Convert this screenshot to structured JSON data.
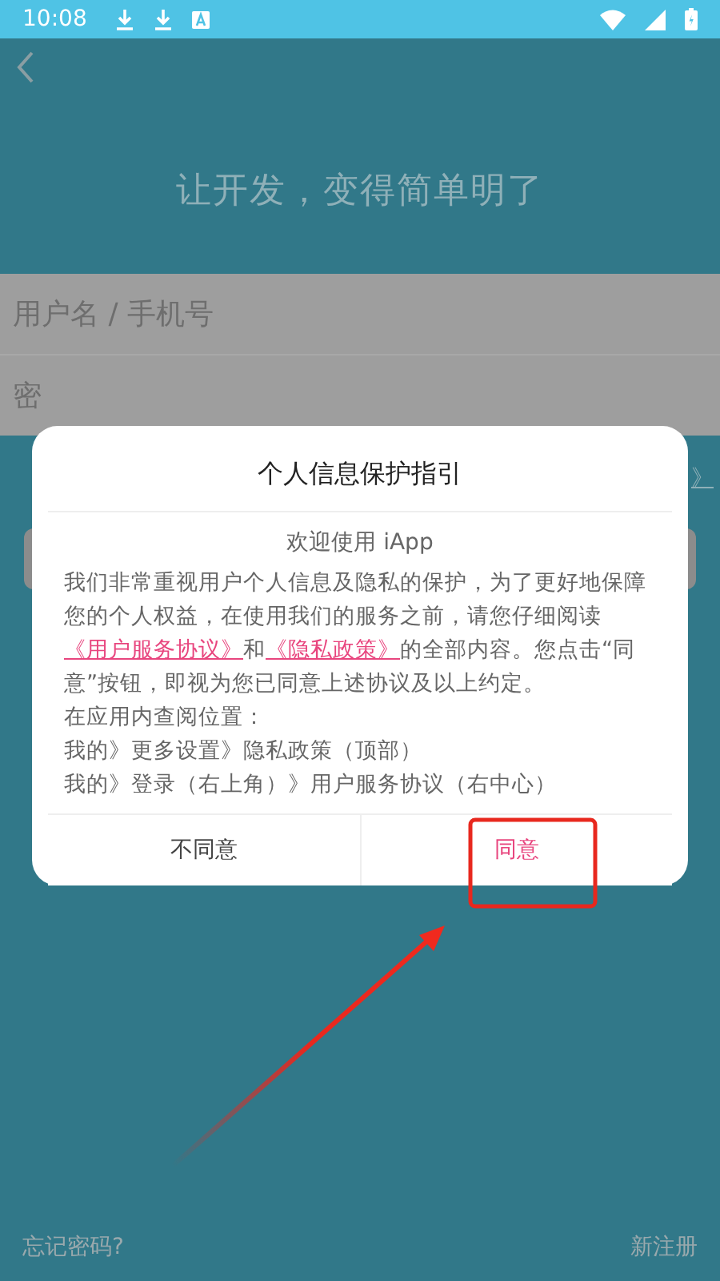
{
  "status_bar": {
    "time": "10:08"
  },
  "page": {
    "slogan": "让开发，变得简单明了",
    "username_field": {
      "placeholder": "用户名 / 手机号"
    },
    "password_field": {
      "placeholder": "密"
    },
    "agreement_link": "》",
    "footer": {
      "forgot": "忘记密码?",
      "register": "新注册"
    }
  },
  "dialog": {
    "title": "个人信息保护指引",
    "welcome": "欢迎使用 iApp",
    "intro": [
      {
        "kind": "text",
        "text": "我们非常重视用户个人信息及隐私的保护，为了更好地保障您的个人权益，在使用我们的服务之前，请您仔细阅读"
      },
      {
        "kind": "link",
        "text": "《用户服务协议》"
      },
      {
        "kind": "text",
        "text": "和"
      },
      {
        "kind": "link",
        "text": "《隐私政策》"
      },
      {
        "kind": "text",
        "text": "的全部内容。您点击“同意”按钮，即视为您已同意上述协议及以上约定。"
      }
    ],
    "locations": [
      "在应用内查阅位置：",
      "我的》更多设置》隐私政策（顶部）",
      "我的》登录（右上角）》用户服务协议（右中心）"
    ],
    "buttons": [
      {
        "label": "不同意",
        "kind": "decline"
      },
      {
        "label": "同意",
        "kind": "accept"
      }
    ]
  }
}
